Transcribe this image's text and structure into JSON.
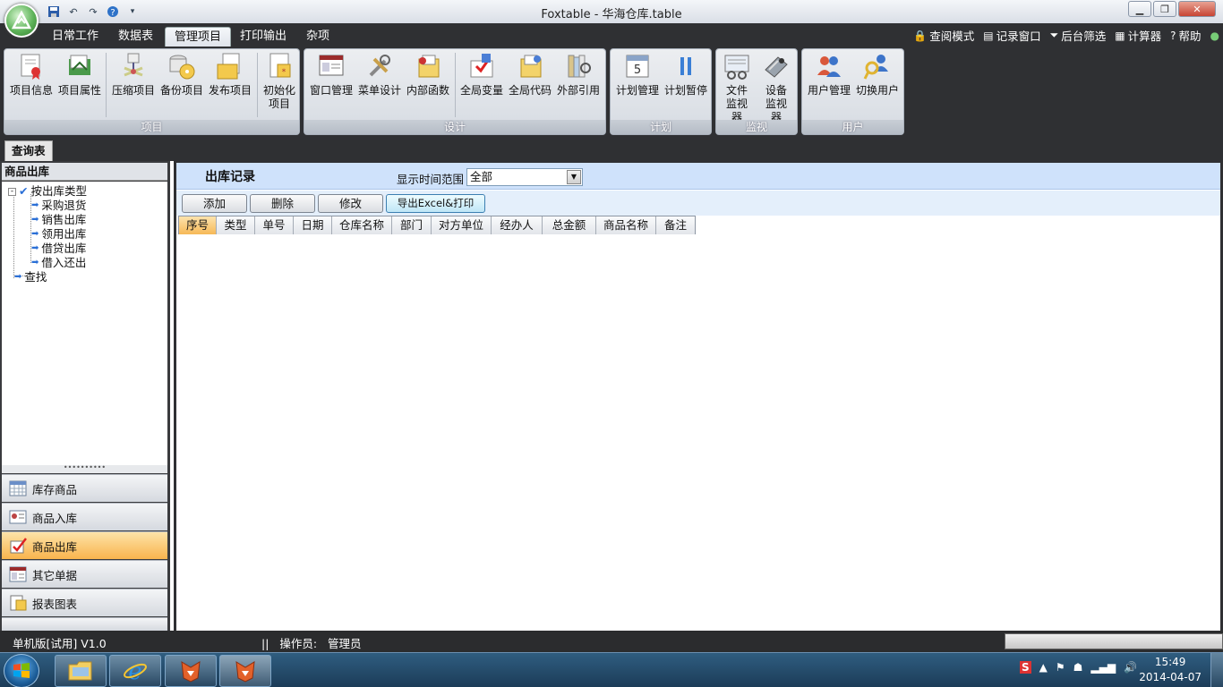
{
  "window": {
    "title": "Foxtable - 华海仓库.table"
  },
  "ribbon_tabs": [
    {
      "label": "日常工作"
    },
    {
      "label": "数据表"
    },
    {
      "label": "管理项目",
      "active": true
    },
    {
      "label": "打印输出"
    },
    {
      "label": "杂项"
    }
  ],
  "right_menu": [
    {
      "label": "查阅模式",
      "icon": "lock-icon"
    },
    {
      "label": "记录窗口",
      "icon": "window-icon"
    },
    {
      "label": "后台筛选",
      "icon": "filter-icon"
    },
    {
      "label": "计算器",
      "icon": "calculator-icon"
    },
    {
      "label": "帮助",
      "icon": "help-icon"
    }
  ],
  "ribbon_groups": {
    "project": {
      "label": "项目",
      "buttons": [
        "项目信息",
        "项目属性",
        "压缩项目",
        "备份项目",
        "发布项目",
        "初始化项目"
      ]
    },
    "design": {
      "label": "设计",
      "buttons": [
        "窗口管理",
        "菜单设计",
        "内部函数",
        "全局变量",
        "全局代码",
        "外部引用"
      ]
    },
    "plan": {
      "label": "计划",
      "buttons": [
        "计划管理",
        "计划暂停"
      ]
    },
    "monitor": {
      "label": "监视",
      "buttons": [
        "文件监视器",
        "设备监视器"
      ]
    },
    "user": {
      "label": "用户",
      "buttons": [
        "用户管理",
        "切换用户"
      ]
    }
  },
  "doc_tab": {
    "label": "查询表"
  },
  "left_pane": {
    "title": "商品出库",
    "tree": {
      "root": "按出库类型",
      "children": [
        "采购退货",
        "销售出库",
        "领用出库",
        "借贷出库",
        "借入还出"
      ],
      "other": "查找"
    },
    "nav": [
      {
        "label": "库存商品",
        "icon": "calendar-grid-icon"
      },
      {
        "label": "商品入库",
        "icon": "id-card-icon"
      },
      {
        "label": "商品出库",
        "icon": "checklist-icon",
        "active": true
      },
      {
        "label": "其它单据",
        "icon": "form-icon"
      },
      {
        "label": "报表图表",
        "icon": "report-icon"
      }
    ]
  },
  "main": {
    "title": "出库记录",
    "range_label": "显示时间范围",
    "range_value": "全部",
    "buttons": {
      "add": "添加",
      "delete": "删除",
      "edit": "修改",
      "export": "导出Excel&打印"
    },
    "columns": [
      "序号",
      "类型",
      "单号",
      "日期",
      "仓库名称",
      "部门",
      "对方单位",
      "经办人",
      "总金额",
      "商品名称",
      "备注"
    ]
  },
  "status": {
    "edition": "单机版[试用] V1.0",
    "sep": "||",
    "operator_label": "操作员:",
    "operator": "管理员"
  },
  "taskbar": {
    "time": "15:49",
    "date": "2014-04-07"
  },
  "colors": {
    "accent": "#f9b44d",
    "filterbar": "#cfe2fb",
    "chrome": "#2f3033"
  }
}
